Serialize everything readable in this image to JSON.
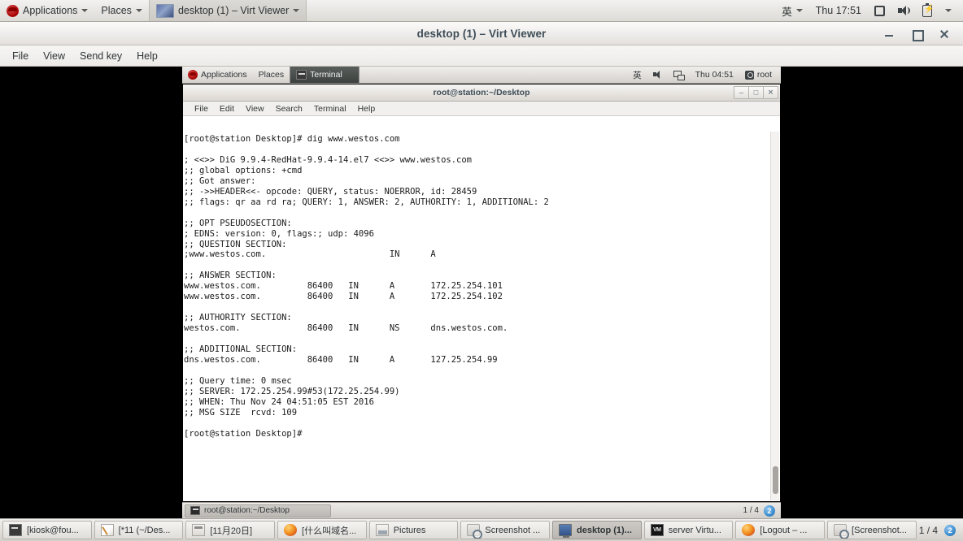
{
  "host_panel": {
    "applications": "Applications",
    "places": "Places",
    "active_window": "desktop (1) – Virt Viewer",
    "input_method": "英",
    "clock": "Thu 17:51",
    "icons": [
      "display-icon",
      "volume-icon",
      "battery-icon",
      "chevron-down-icon"
    ]
  },
  "virt_viewer": {
    "title": "desktop (1) – Virt Viewer",
    "menu": [
      "File",
      "View",
      "Send key",
      "Help"
    ],
    "window_controls": [
      "minimize",
      "maximize",
      "close"
    ]
  },
  "guest_panel": {
    "applications": "Applications",
    "places": "Places",
    "active_window": "Terminal",
    "input_method": "英",
    "clock": "Thu 04:51",
    "user": "root"
  },
  "terminal": {
    "title": "root@station:~/Desktop",
    "menu": [
      "File",
      "Edit",
      "View",
      "Search",
      "Terminal",
      "Help"
    ],
    "window_controls": [
      "minimize",
      "maximize",
      "close"
    ],
    "lines": [
      "[root@station Desktop]# dig www.westos.com",
      "",
      "; <<>> DiG 9.9.4-RedHat-9.9.4-14.el7 <<>> www.westos.com",
      ";; global options: +cmd",
      ";; Got answer:",
      ";; ->>HEADER<<- opcode: QUERY, status: NOERROR, id: 28459",
      ";; flags: qr aa rd ra; QUERY: 1, ANSWER: 2, AUTHORITY: 1, ADDITIONAL: 2",
      "",
      ";; OPT PSEUDOSECTION:",
      "; EDNS: version: 0, flags:; udp: 4096",
      ";; QUESTION SECTION:",
      ";www.westos.com.                        IN      A",
      "",
      ";; ANSWER SECTION:",
      "www.westos.com.         86400   IN      A       172.25.254.101",
      "www.westos.com.         86400   IN      A       172.25.254.102",
      "",
      ";; AUTHORITY SECTION:",
      "westos.com.             86400   IN      NS      dns.westos.com.",
      "",
      ";; ADDITIONAL SECTION:",
      "dns.westos.com.         86400   IN      A       127.25.254.99",
      "",
      ";; Query time: 0 msec",
      ";; SERVER: 172.25.254.99#53(172.25.254.99)",
      ";; WHEN: Thu Nov 24 04:51:05 EST 2016",
      ";; MSG SIZE  rcvd: 109",
      "",
      "[root@station Desktop]#"
    ]
  },
  "guest_taskbar": {
    "task_label": "root@station:~/Desktop",
    "workspace_pages": "1 / 4",
    "workspace_badge": "2"
  },
  "host_taskbar": {
    "tasks": [
      {
        "label": "[kiosk@fou...",
        "icon": "terminal-icon",
        "selected": false
      },
      {
        "label": "[*11 (~/Des...",
        "icon": "text-editor-icon",
        "selected": false
      },
      {
        "label": "[11月20日]",
        "icon": "calculator-icon",
        "selected": false
      },
      {
        "label": "[什么叫域名...",
        "icon": "firefox-icon",
        "selected": false
      },
      {
        "label": "Pictures",
        "icon": "pictures-icon",
        "selected": false
      },
      {
        "label": "Screenshot ...",
        "icon": "screenshot-icon",
        "selected": false
      },
      {
        "label": "desktop (1)...",
        "icon": "monitor-icon",
        "selected": true
      },
      {
        "label": "server Virtu...",
        "icon": "virt-manager-icon",
        "selected": false
      },
      {
        "label": "[Logout – ...",
        "icon": "firefox-icon",
        "selected": false
      },
      {
        "label": "[Screenshot...",
        "icon": "screenshot-icon",
        "selected": false
      }
    ],
    "workspace_pages": "1 / 4",
    "workspace_badge": "2"
  },
  "colors": {
    "panel_bg": "#e2dfdb",
    "terminal_bg": "#ffffff",
    "terminal_fg": "#1a1a1a",
    "desktop_black": "#000000",
    "accent_blue": "#3f8fd0",
    "redhat_red": "#a30000"
  }
}
